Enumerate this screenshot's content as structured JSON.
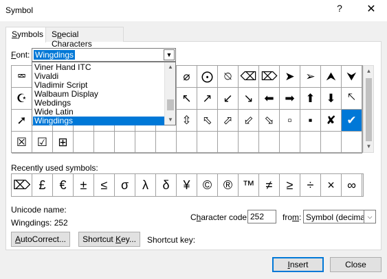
{
  "window": {
    "title": "Symbol",
    "help_glyph": "?",
    "close_glyph": "✕"
  },
  "tabs": [
    {
      "label": "Symbols",
      "underline": "S",
      "rest": "ymbols"
    },
    {
      "label": "Special Characters",
      "pre": "S",
      "underline": "p",
      "rest": "ecial Characters"
    }
  ],
  "font": {
    "label_underline": "F",
    "label_rest": "ont:",
    "value": "Wingdings",
    "options": [
      "Viner Hand ITC",
      "Vivaldi",
      "Vladimir Script",
      "Walbaum Display",
      "Webdings",
      "Wide Latin",
      "Wingdings"
    ],
    "selected_index": 6
  },
  "symbols": [
    [
      "☞",
      "☝",
      "☟",
      "☚",
      "☛",
      "☜",
      "☞",
      "✌",
      "☹",
      "☺",
      "☻",
      "⌫",
      "⌦",
      "➤",
      "➢",
      "⮝",
      "⮟"
    ],
    [
      "◐",
      "⯇",
      "⯈",
      "⯅",
      "⯆",
      "⮜",
      "⮞",
      "⮝",
      "⮟",
      "↖",
      "↗",
      "↙",
      "↘",
      "🡄",
      "🡆",
      "🡅",
      "🡇",
      "🡔"
    ],
    [
      "🡕",
      "🡗",
      "🡖",
      "⇦",
      "⇨",
      "⇧",
      "⇩",
      "⬄",
      "⇳",
      "⬀",
      "⬁",
      "⬃",
      "⬂",
      "▭",
      "▫",
      "✗",
      "✓"
    ],
    [
      "☒",
      "☑",
      "⊞"
    ]
  ],
  "visible_cells": {
    "row0_right": [
      "⌀",
      "⨀",
      "⍉",
      "⌫",
      "⌦",
      "➤",
      "➢",
      "⮝",
      "⮟"
    ],
    "row1": [
      "◐",
      "",
      "",
      "",
      "",
      "",
      "",
      "",
      "↖",
      "↗",
      "↙",
      "↘",
      "⬅",
      "➡",
      "⬆",
      "⬇",
      "🡔"
    ],
    "row1_first": "☪",
    "row2": [
      "➚",
      "",
      "",
      "",
      "",
      "",
      "",
      "",
      "⇳",
      "⬁",
      "⬀",
      "⬃",
      "⬂",
      "▫",
      "▪",
      "✘",
      "✔"
    ],
    "row0_first": "⮹",
    "row3": [
      "☒",
      "☑",
      "⊞"
    ]
  },
  "recent": {
    "label": "Recently used symbols:",
    "symbols": [
      "⌦",
      "£",
      "€",
      "±",
      "≤",
      "σ",
      "λ",
      "δ",
      "¥",
      "©",
      "®",
      "™",
      "≠",
      "≥",
      "÷",
      "×",
      "∞"
    ]
  },
  "unicode": {
    "label": "Unicode name:",
    "value": "Wingdings: 252"
  },
  "character_code": {
    "label_pre": "C",
    "label_underline": "h",
    "label_rest": "aracter code:",
    "value": "252"
  },
  "from": {
    "label_pre": "fro",
    "label_underline": "m",
    "label_rest": ":",
    "value": "Symbol (decimal)"
  },
  "buttons": {
    "autocorrect": {
      "underline": "A",
      "rest": "utoCorrect..."
    },
    "shortcut_key": {
      "pre": "Shortcut ",
      "underline": "K",
      "rest": "ey..."
    },
    "shortcut_key_label": "Shortcut key:",
    "insert": {
      "underline": "I",
      "rest": "nsert"
    },
    "close": "Close"
  }
}
